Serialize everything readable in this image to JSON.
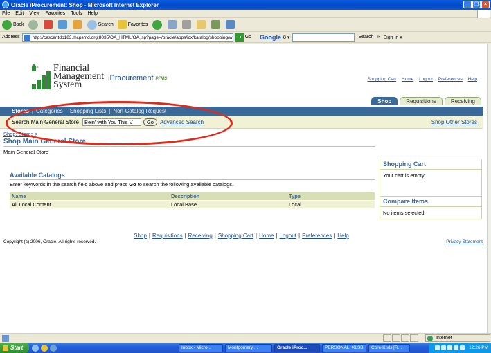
{
  "window": {
    "title": "Oracle iProcurement: Shop - Microsoft Internet Explorer",
    "buttons": {
      "minimize": "_",
      "maximize": "❐",
      "close": "×"
    }
  },
  "menubar": [
    "File",
    "Edit",
    "View",
    "Favorites",
    "Tools",
    "Help"
  ],
  "toolbar": {
    "back": "Back",
    "search": "Search",
    "favorites": "Favorites"
  },
  "address": {
    "label": "Address",
    "url": "http://cescentdb183.mcpsmd.org:8035/OA_HTML/OA.jsp?page=/oracle/apps/icx/katalog/shopping/w",
    "go": "Go",
    "google": "Google",
    "google_g": "8 ▾",
    "search_label": "Search",
    "more": "»",
    "sign_in": "Sign In ▾"
  },
  "app": {
    "logo_curve": "mcps",
    "logo_line1": "Financial",
    "logo_line2": "Management",
    "logo_line3": "System",
    "product": "iProcurement",
    "product_tag": "PFMS",
    "global_links": [
      "Shopping Cart",
      "Home",
      "Logout",
      "Preferences",
      "Help"
    ],
    "tabs": [
      {
        "label": "Shop",
        "active": true
      },
      {
        "label": "Requisitions",
        "active": false
      },
      {
        "label": "Receiving",
        "active": false
      }
    ],
    "subnav": [
      {
        "label": "Stores",
        "active": true
      },
      {
        "label": "Categories",
        "active": false
      },
      {
        "label": "Shopping Lists",
        "active": false
      },
      {
        "label": "Non-Catalog Request",
        "active": false
      }
    ],
    "search": {
      "label": "Search Main General Store",
      "value": "Bein' with You This V",
      "go": "Go",
      "advanced": "Advanced Search",
      "shop_other": "Shop Other Stores"
    },
    "breadcrumb": {
      "link": "Shop: Stores",
      "sep": ">"
    },
    "page_title": "Shop Main General Store",
    "store_description": "Main General Store",
    "catalogs": {
      "heading": "Available Catalogs",
      "instruction_pre": "Enter keywords in the search field above and press ",
      "instruction_go": "Go",
      "instruction_post": " to search the following available catalogs.",
      "columns": [
        "Name",
        "Description",
        "Type"
      ],
      "rows": [
        [
          "All Local Content",
          "Local Base",
          "Local"
        ]
      ]
    },
    "shopping_cart": {
      "heading": "Shopping Cart",
      "body": "Your cart is empty."
    },
    "compare_items": {
      "heading": "Compare Items",
      "body": "No items selected."
    },
    "footer_links": [
      "Shop",
      "Requisitions",
      "Receiving",
      "Shopping Cart",
      "Home",
      "Logout",
      "Preferences",
      "Help"
    ],
    "footer_sep": "|",
    "copyright": "Copyright (c) 2006, Oracle. All rights reserved.",
    "privacy": "Privacy Statement"
  },
  "statusbar": {
    "zone": "Internet"
  },
  "taskbar": {
    "start": "Start",
    "tasks": [
      {
        "label": "Inbox - Micro...",
        "active": false
      },
      {
        "label": "Montgomery ...",
        "active": false
      },
      {
        "label": "Oracle iProc...",
        "active": true
      },
      {
        "label": "PERSONAL_XLSB",
        "active": false
      },
      {
        "label": "Core-K.xls [R...",
        "active": false
      }
    ],
    "clock": "12:26 PM"
  }
}
